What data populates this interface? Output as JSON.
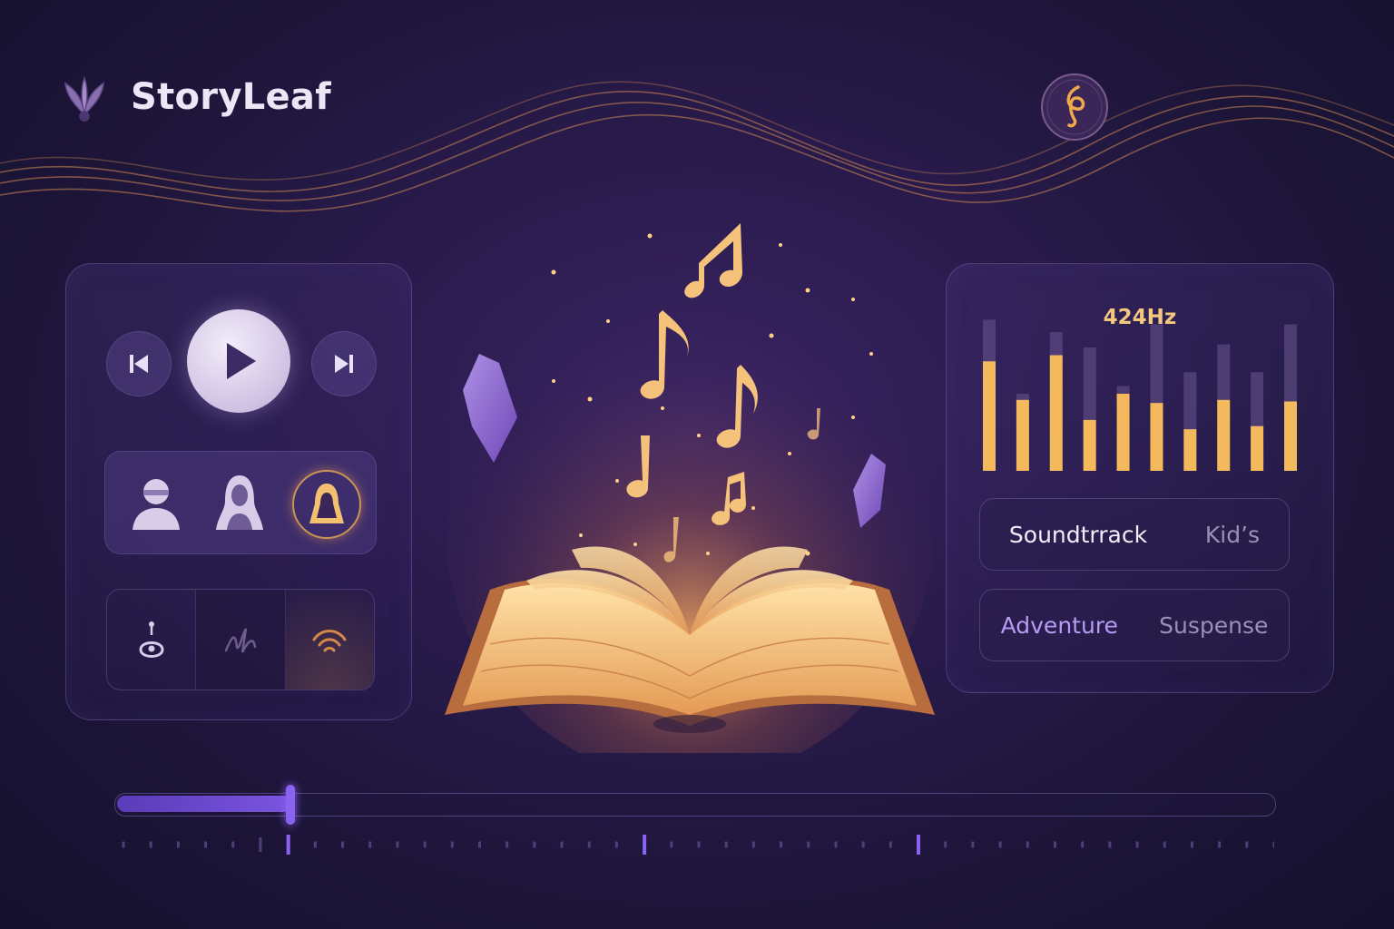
{
  "app": {
    "title": "StoryLeaf",
    "logo_icon": "leaf-spark-icon",
    "emblem_icon": "treble-clef-emblem-icon"
  },
  "player": {
    "prev_icon": "skip-previous-icon",
    "play_icon": "play-icon",
    "next_icon": "skip-next-icon",
    "narrators": [
      "narrator-male-icon",
      "narrator-female-icon",
      "narrator-selected-icon"
    ],
    "ambient": [
      "chime-icon",
      "script-icon",
      "wave-sound-icon"
    ]
  },
  "equalizer": {
    "frequency_label": "424Hz",
    "levels": [
      0.71,
      0.46,
      0.75,
      0.33,
      0.5,
      0.44,
      0.27,
      0.46,
      0.29,
      0.45
    ]
  },
  "genres": {
    "row1": [
      "Soundtrrack",
      "Kid’s"
    ],
    "row2": [
      "Adventure",
      "Suspense"
    ]
  },
  "timeline": {
    "progress": 0.15
  },
  "colors": {
    "accent_gold": "#f3c77d",
    "accent_purple": "#8b63f0",
    "background": "#2a1b4d"
  }
}
